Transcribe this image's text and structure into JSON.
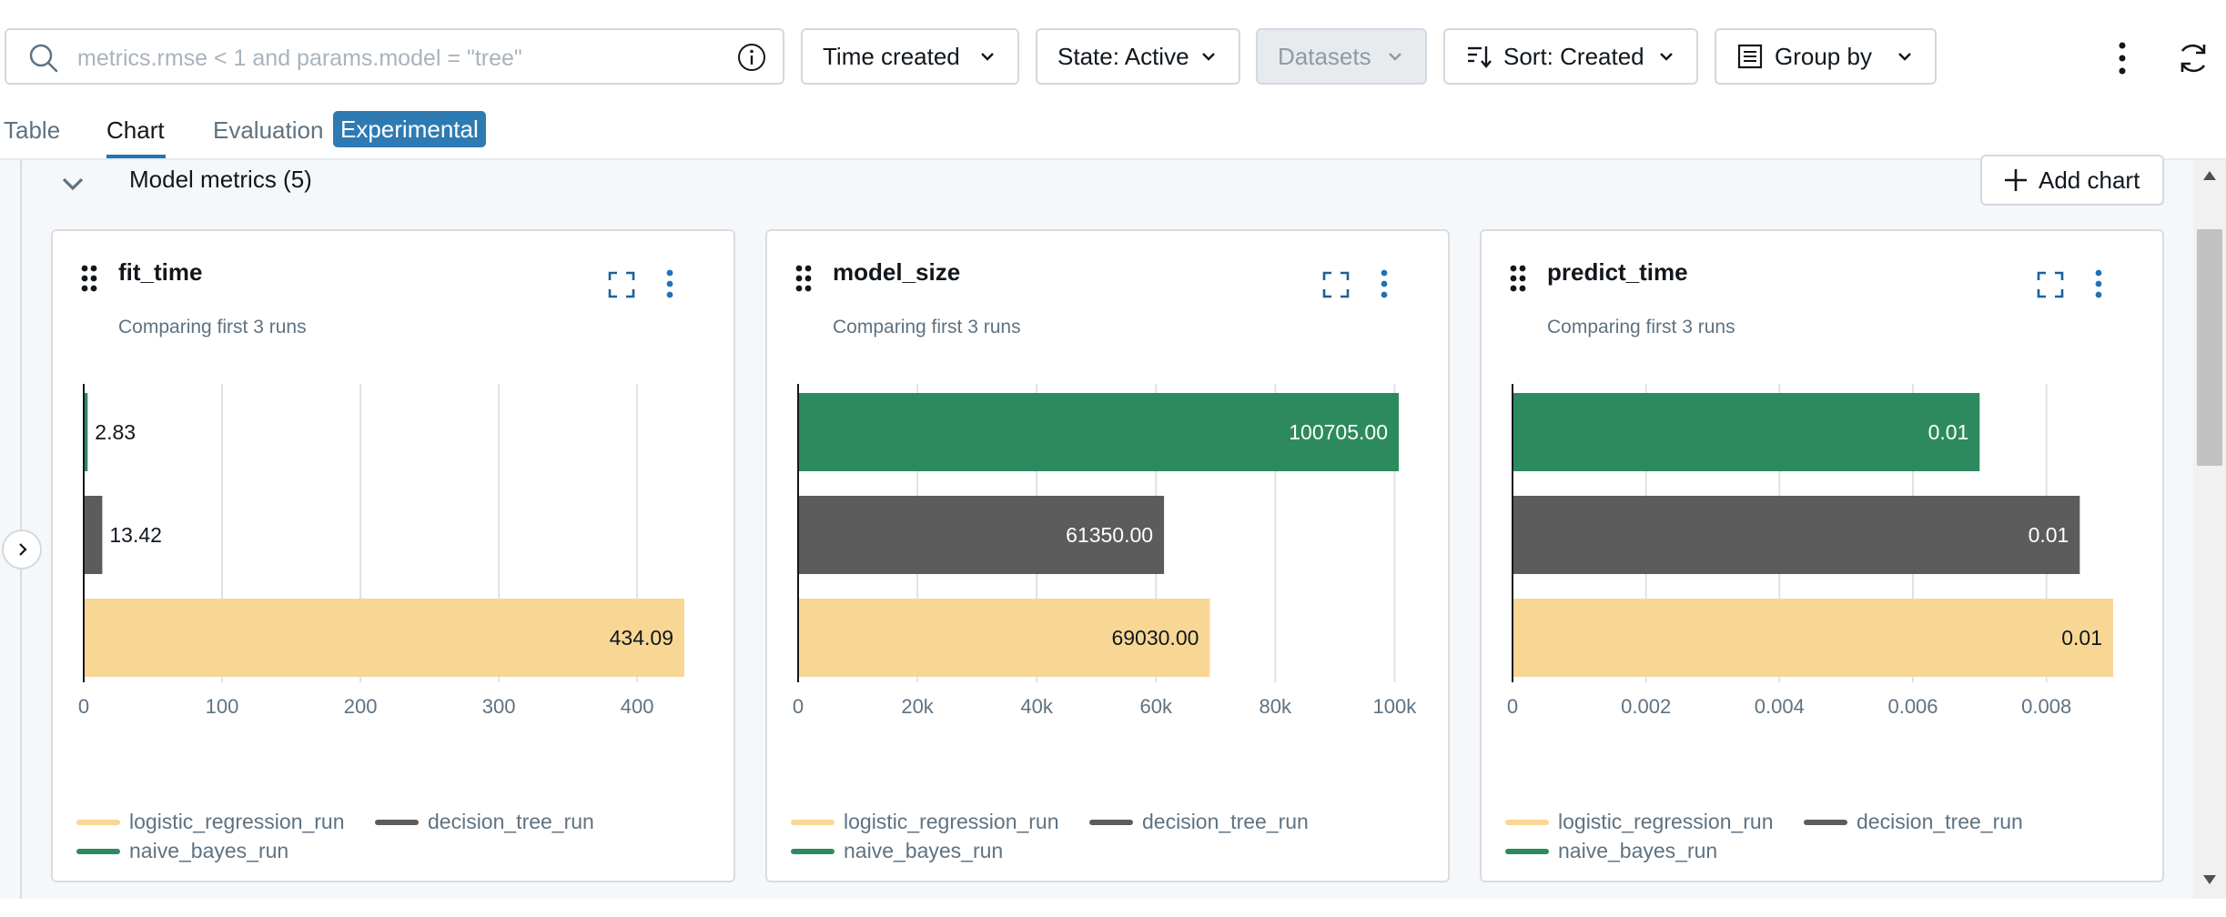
{
  "search": {
    "placeholder": "metrics.rmse < 1 and params.model = \"tree\"",
    "value": ""
  },
  "filters": {
    "time_created": "Time created",
    "state": "State: Active",
    "datasets": "Datasets",
    "sort": "Sort: Created",
    "group_by": "Group by"
  },
  "tabs": [
    {
      "label": "Table",
      "active": false
    },
    {
      "label": "Chart",
      "active": true
    },
    {
      "label": "Evaluation",
      "active": false
    }
  ],
  "tab_badge": "Experimental",
  "section": {
    "title": "Model metrics (5)",
    "add_chart_label": "Add chart"
  },
  "colors": {
    "logistic_regression_run": "#f8d794",
    "decision_tree_run": "#5c5c5c",
    "naive_bayes_run": "#2d8a5f",
    "accent": "#2272b4"
  },
  "legend": [
    "logistic_regression_run",
    "decision_tree_run",
    "naive_bayes_run"
  ],
  "cards": [
    {
      "title": "fit_time",
      "subtitle": "Comparing first 3 runs"
    },
    {
      "title": "model_size",
      "subtitle": "Comparing first 3 runs"
    },
    {
      "title": "predict_time",
      "subtitle": "Comparing first 3 runs"
    }
  ],
  "chart_data": [
    {
      "type": "bar",
      "orientation": "horizontal",
      "title": "fit_time",
      "subtitle": "Comparing first 3 runs",
      "categories": [
        "naive_bayes_run",
        "decision_tree_run",
        "logistic_regression_run"
      ],
      "values": [
        2.83,
        13.42,
        434.09
      ],
      "labels": [
        "2.83",
        "13.42",
        "434.09"
      ],
      "xlim": [
        0,
        434.09
      ],
      "ticks": [
        0,
        100,
        200,
        300,
        400
      ],
      "tick_labels": [
        "0",
        "100",
        "200",
        "300",
        "400"
      ],
      "grid": true,
      "legend_position": "bottom"
    },
    {
      "type": "bar",
      "orientation": "horizontal",
      "title": "model_size",
      "subtitle": "Comparing first 3 runs",
      "categories": [
        "naive_bayes_run",
        "decision_tree_run",
        "logistic_regression_run"
      ],
      "values": [
        100705.0,
        61350.0,
        69030.0
      ],
      "labels": [
        "100705.00",
        "61350.00",
        "69030.00"
      ],
      "xlim": [
        0,
        100705
      ],
      "ticks": [
        0,
        20000,
        40000,
        60000,
        80000,
        100000
      ],
      "tick_labels": [
        "0",
        "20k",
        "40k",
        "60k",
        "80k",
        "100k"
      ],
      "grid": true,
      "legend_position": "bottom"
    },
    {
      "type": "bar",
      "orientation": "horizontal",
      "title": "predict_time",
      "subtitle": "Comparing first 3 runs",
      "categories": [
        "naive_bayes_run",
        "decision_tree_run",
        "logistic_regression_run"
      ],
      "values": [
        0.007,
        0.0085,
        0.009
      ],
      "labels": [
        "0.01",
        "0.01",
        "0.01"
      ],
      "xlim": [
        0,
        0.009
      ],
      "ticks": [
        0,
        0.002,
        0.004,
        0.006,
        0.008
      ],
      "tick_labels": [
        "0",
        "0.002",
        "0.004",
        "0.006",
        "0.008"
      ],
      "grid": true,
      "legend_position": "bottom"
    }
  ]
}
